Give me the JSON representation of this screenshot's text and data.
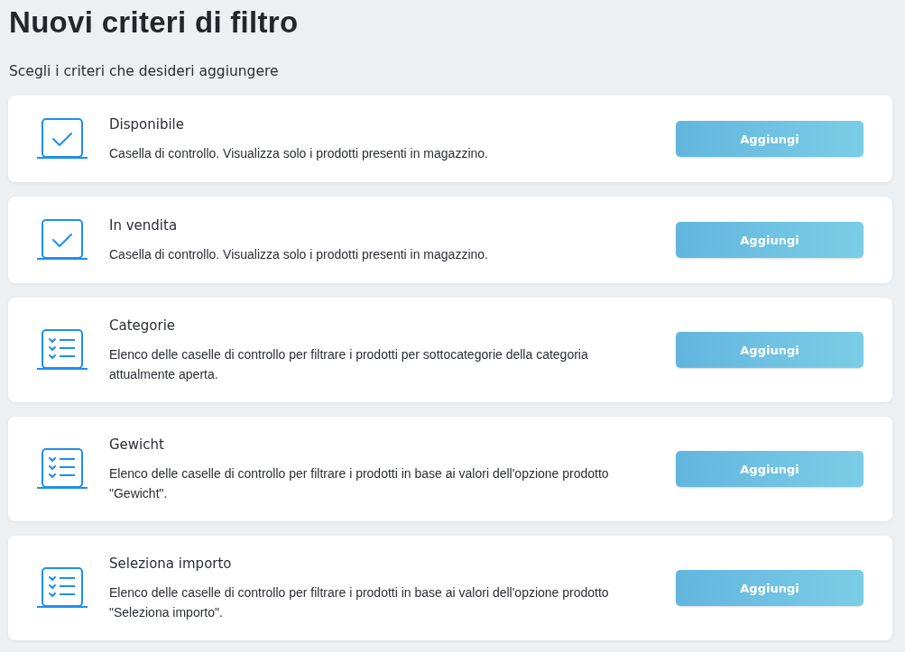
{
  "title": "Nuovi criteri di filtro",
  "subtitle": "Scegli i criteri che desideri aggiungere",
  "criteria": [
    {
      "kind": "checkbox",
      "name": "Disponibile",
      "description": "Casella di controllo. Visualizza solo i prodotti presenti in magazzino.",
      "button": "Aggiungi"
    },
    {
      "kind": "checkbox",
      "name": "In vendita",
      "description": "Casella di controllo. Visualizza solo i prodotti presenti in magazzino.",
      "button": "Aggiungi"
    },
    {
      "kind": "list",
      "name": "Categorie",
      "description": "Elenco delle caselle di controllo per filtrare i prodotti per sottocategorie della categoria attualmente aperta.",
      "button": "Aggiungi"
    },
    {
      "kind": "list",
      "name": "Gewicht",
      "description": "Elenco delle caselle di controllo per filtrare i prodotti in base ai valori dell'opzione prodotto \"Gewicht\".",
      "button": "Aggiungi"
    },
    {
      "kind": "list",
      "name": "Seleziona importo",
      "description": "Elenco delle caselle di controllo per filtrare i prodotti in base ai valori dell'opzione prodotto \"Seleziona importo\".",
      "button": "Aggiungi"
    }
  ]
}
